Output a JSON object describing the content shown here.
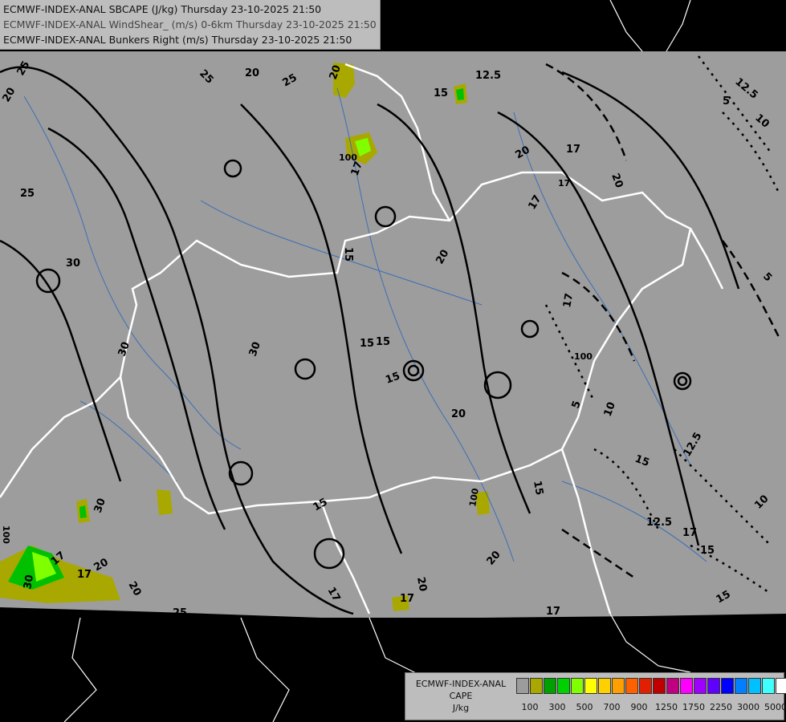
{
  "header": {
    "line1": "ECMWF-INDEX-ANAL SBCAPE (J/kg) Thursday 23-10-2025 21:50",
    "line2": "ECMWF-INDEX-ANAL WindShear_ (m/s) 0-6km Thursday 23-10-2025 21:50",
    "line3": "ECMWF-INDEX-ANAL Bunkers Right (m/s) Thursday 23-10-2025 21:50"
  },
  "legend": {
    "title_line1": "ECMWF-INDEX-ANAL",
    "title_line2": "CAPE",
    "title_line3": "J/kg",
    "colors": [
      "#9c9c9c",
      "#a8a800",
      "#00a000",
      "#00d000",
      "#80ff00",
      "#ffff00",
      "#ffd000",
      "#ffa000",
      "#ff6000",
      "#e02000",
      "#c00000",
      "#c00080",
      "#ff00ff",
      "#a000ff",
      "#6000ff",
      "#0000ff",
      "#0080ff",
      "#00c0ff",
      "#40ffff",
      "#ffffff"
    ],
    "tick_labels": [
      "100",
      "300",
      "500",
      "700",
      "900",
      "1250",
      "1750",
      "2250",
      "3000",
      "5000"
    ]
  },
  "contour_labels": [
    "25",
    "20",
    "25",
    "20",
    "25",
    "12.5",
    "15",
    "17",
    "20",
    "20",
    "17",
    "15",
    "100",
    "17",
    "20",
    "17",
    "15",
    "10",
    "5",
    "5",
    "12.5",
    "25",
    "30",
    "30",
    "15",
    "15",
    "15",
    "20",
    "20",
    "30",
    "15",
    "17",
    "20",
    "17",
    "15",
    "20",
    "17",
    "20",
    "12.5",
    "17",
    "15",
    "12.5",
    "10",
    "15",
    "100",
    "15",
    "17",
    "20",
    "5",
    "10",
    "25",
    "30",
    "100",
    "100",
    "30",
    "17",
    "17"
  ],
  "colors": {
    "background": "#000000",
    "map_fill": "#9d9d9d",
    "border_lines": "#ffffff",
    "rivers": "#3d6fb5",
    "contours": "#000000"
  }
}
